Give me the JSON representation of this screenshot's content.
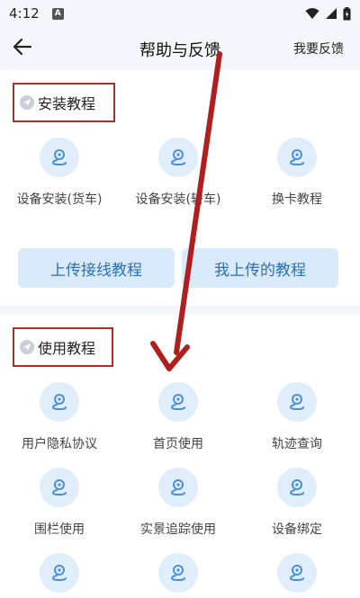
{
  "status": {
    "time": "4:12",
    "notification_badge": "A"
  },
  "header": {
    "title": "帮助与反馈",
    "feedback_label": "我要反馈"
  },
  "install_section": {
    "title": "安装教程",
    "items": [
      {
        "label": "设备安装(货车)",
        "icon": "location-pin-route-icon"
      },
      {
        "label": "设备安装(轿车)",
        "icon": "location-pin-route-icon"
      },
      {
        "label": "换卡教程",
        "icon": "location-pin-route-icon"
      }
    ],
    "buttons": {
      "upload_wiring": "上传接线教程",
      "my_uploads": "我上传的教程"
    }
  },
  "usage_section": {
    "title": "使用教程",
    "items": [
      {
        "label": "用户隐私协议",
        "icon": "location-pin-route-icon"
      },
      {
        "label": "首页使用",
        "icon": "location-pin-route-icon"
      },
      {
        "label": "轨迹查询",
        "icon": "location-pin-route-icon"
      },
      {
        "label": "围栏使用",
        "icon": "location-pin-route-icon"
      },
      {
        "label": "实景追踪使用",
        "icon": "location-pin-route-icon"
      },
      {
        "label": "设备绑定",
        "icon": "location-pin-route-icon"
      },
      {
        "label": "",
        "icon": "location-pin-route-icon"
      },
      {
        "label": "",
        "icon": "location-pin-route-icon"
      },
      {
        "label": "",
        "icon": "location-pin-route-icon"
      }
    ]
  },
  "colors": {
    "accent_blue": "#4a90d9",
    "icon_bg": "#dfeefa",
    "annotation_red": "#b22a2a",
    "page_bg": "#f3f6fa"
  }
}
